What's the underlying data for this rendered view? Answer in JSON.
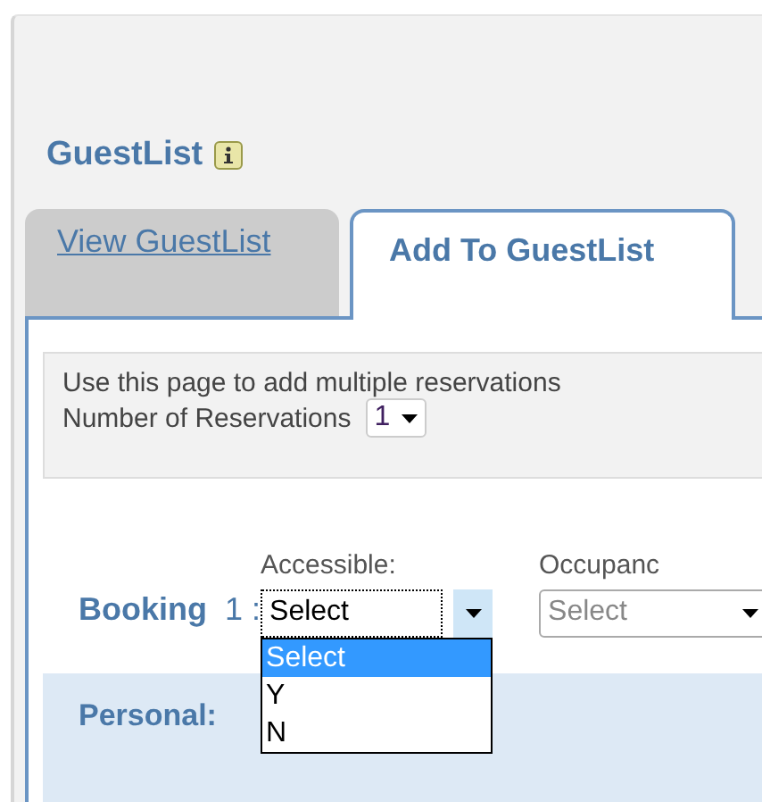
{
  "title": "GuestList",
  "tabs": [
    {
      "label": "View GuestList",
      "selected": false
    },
    {
      "label": "Add To GuestList",
      "selected": true
    }
  ],
  "intro": {
    "text": "Use this page to add multiple reservations",
    "count_label": "Number of Reservations",
    "count_value": "1"
  },
  "booking": {
    "label": "Booking",
    "number": "1 :",
    "fields": [
      {
        "label": "Accessible:",
        "value": "Select",
        "open": true,
        "options": [
          {
            "label": "Select",
            "selected": true
          },
          {
            "label": "Y",
            "selected": false
          },
          {
            "label": "N",
            "selected": false
          }
        ]
      },
      {
        "label": "Occupanc",
        "value": "Select",
        "open": false
      }
    ]
  },
  "section": "Personal:"
}
